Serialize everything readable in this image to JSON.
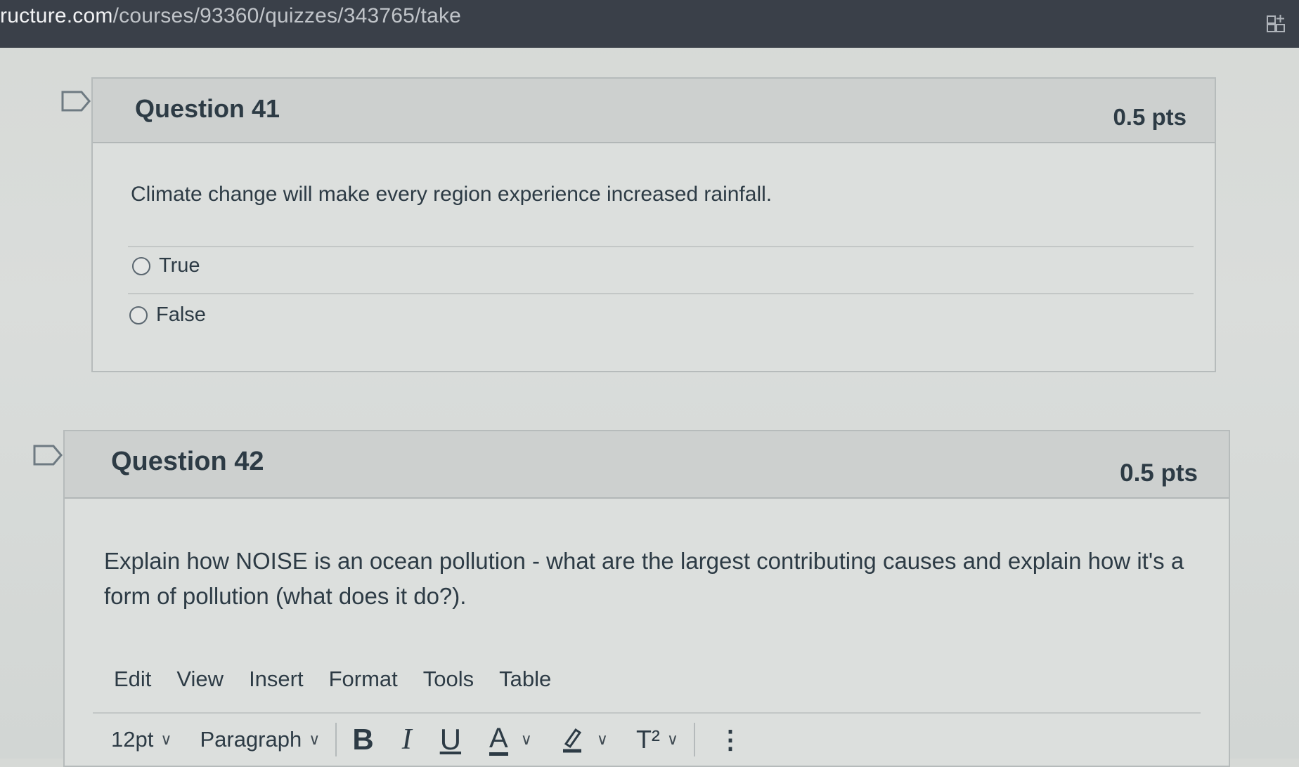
{
  "browser": {
    "url_host": "ructure.com",
    "url_path": "/courses/93360/quizzes/343765/take",
    "extension_icon": "extension-icon"
  },
  "questions": [
    {
      "title": "Question 41",
      "points": "0.5 pts",
      "text": "Climate change will make every region experience increased rainfall.",
      "answers": [
        "True",
        "False"
      ]
    },
    {
      "title": "Question 42",
      "points": "0.5 pts",
      "text": "Explain how NOISE is an ocean pollution - what are the largest contributing causes and explain how it's a form of pollution (what does it do?).",
      "editor": {
        "menu": [
          "Edit",
          "View",
          "Insert",
          "Format",
          "Tools",
          "Table"
        ],
        "font_size": "12pt",
        "block_format": "Paragraph",
        "bold": "B",
        "italic": "I",
        "underline": "U",
        "text_color": "A",
        "superscript": "T²",
        "more": "⋮"
      }
    }
  ],
  "colors": {
    "text": "#2d3b45",
    "card_bg": "#dcdfdd",
    "header_bg": "#cdd0cf",
    "urlbar_bg": "#3a4049"
  }
}
